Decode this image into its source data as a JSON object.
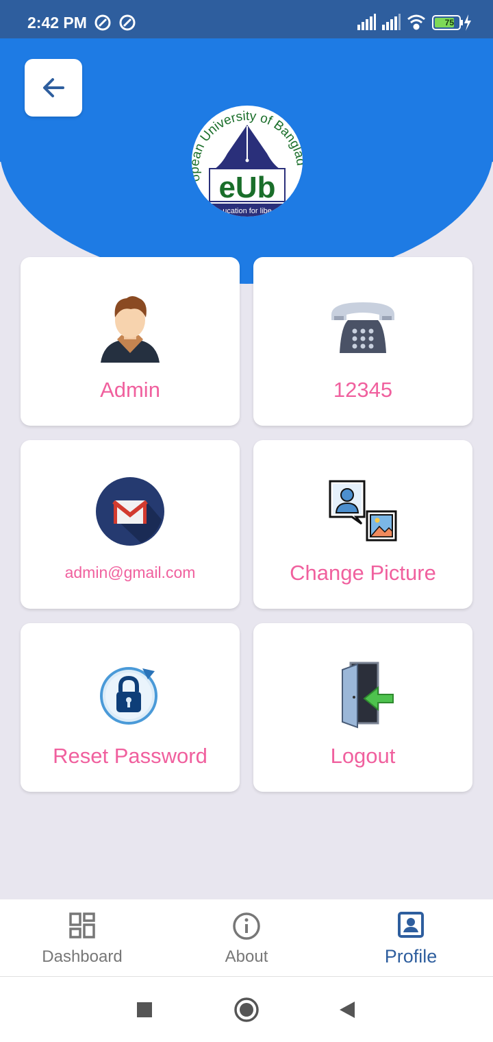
{
  "status_bar": {
    "time": "2:42 PM",
    "battery": "75"
  },
  "header": {
    "logo_text_arc": "opean University of Banglad",
    "logo_text_main": "eUb",
    "logo_text_tagline": "ucation for libe"
  },
  "cards": [
    {
      "label": "Admin",
      "icon": "user-avatar-icon"
    },
    {
      "label": "12345",
      "icon": "telephone-icon"
    },
    {
      "label": "admin@gmail.com",
      "icon": "gmail-icon"
    },
    {
      "label": "Change Picture",
      "icon": "change-picture-icon"
    },
    {
      "label": "Reset Password",
      "icon": "reset-password-lock-icon"
    },
    {
      "label": "Logout",
      "icon": "logout-door-icon"
    }
  ],
  "bottom_nav": {
    "items": [
      {
        "label": "Dashboard",
        "icon": "dashboard-icon"
      },
      {
        "label": "About",
        "icon": "info-icon"
      },
      {
        "label": "Profile",
        "icon": "profile-icon",
        "active": true
      }
    ]
  },
  "colors": {
    "header": "#1e7be4",
    "status_bar": "#2e5e9e",
    "label_pink": "#f0609e",
    "active_nav": "#2e5e9e",
    "background": "#e8e6ef"
  }
}
